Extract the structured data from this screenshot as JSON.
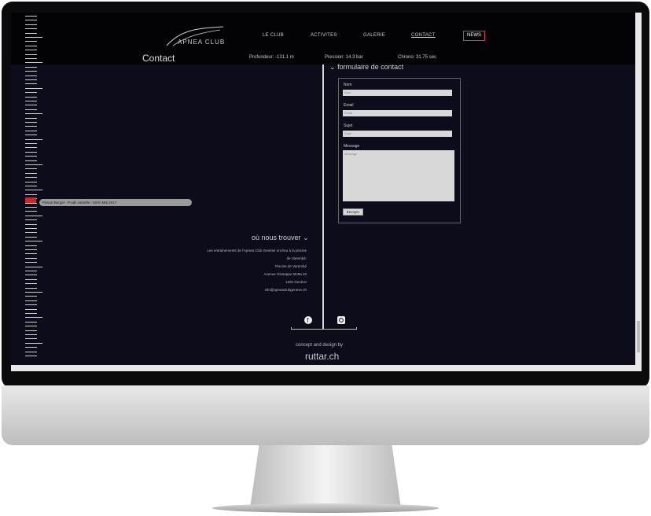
{
  "nav": {
    "logo_text": "APNEA CLUB",
    "items": [
      "LE CLUB",
      "ACTIVITES",
      "GALERIE",
      "CONTACT"
    ],
    "news": "NEWS"
  },
  "page": {
    "title": "Contact"
  },
  "stats": {
    "depth": "Profondeur: -131.1 m",
    "pressure": "Pression: 14.3 bar",
    "chrono": "Chrono: 31.75 sec"
  },
  "gauge": {
    "marker_label": "Pascal Berger - Poids variable -130m Mai 2017"
  },
  "form": {
    "title": "formulaire de contact",
    "name_label": "Nom",
    "name_placeholder": "Nom",
    "email_label": "Email",
    "email_placeholder": "Email",
    "subject_label": "Sujet",
    "subject_placeholder": "Sujet",
    "message_label": "Message",
    "message_placeholder": "Message",
    "submit": "Envoyer"
  },
  "location": {
    "title": "où nous trouver",
    "lines": [
      "Les entrainements de l'Apnea Club Genève ont lieu à la piscine",
      "de Varembé:",
      "Piscine de Varembé",
      "Avenue Giuseppe Motta 46",
      "1202 Genève",
      "info@apneaclubgeneve.ch"
    ]
  },
  "footer": {
    "credit": "concept and design by",
    "brand": "ruttar.ch",
    "social_icons": [
      "facebook-icon",
      "instagram-icon"
    ]
  },
  "colors": {
    "accent": "#e02020",
    "background": "#0d0c1b"
  }
}
